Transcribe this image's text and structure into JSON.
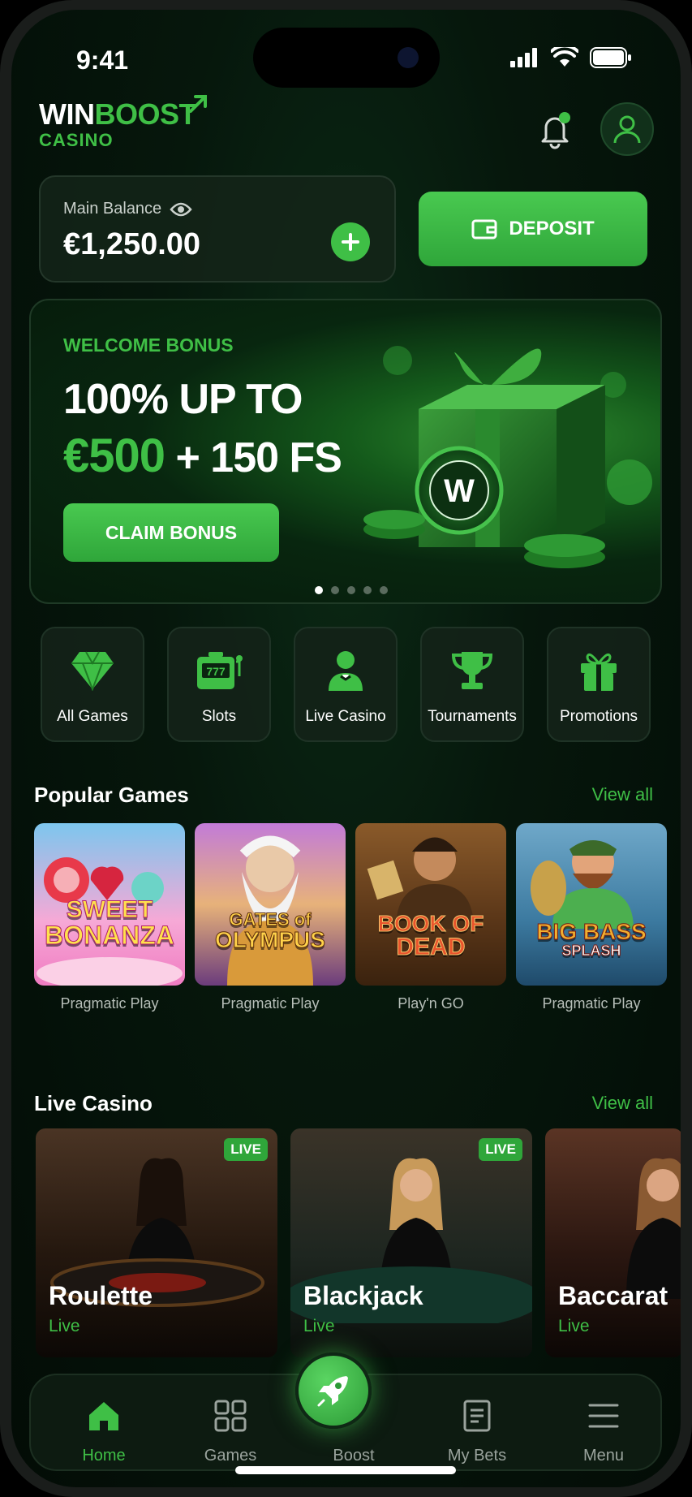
{
  "status_bar": {
    "time": "9:41"
  },
  "header": {
    "logo_win": "WIN",
    "logo_boost": "BOOST",
    "logo_sub": "CASINO"
  },
  "balance": {
    "label": "Main Balance",
    "value": "€1,250.00"
  },
  "deposit": {
    "label": "DEPOSIT"
  },
  "promo": {
    "kicker": "WELCOME BONUS",
    "line1": "100% UP TO",
    "amount": "€500",
    "line2_rest": "+ 150 FS",
    "cta": "CLAIM BONUS",
    "slide_count": 5,
    "active_slide": 1
  },
  "categories": [
    {
      "label": "All Games",
      "icon": "diamond-icon"
    },
    {
      "label": "Slots",
      "icon": "slot-machine-icon"
    },
    {
      "label": "Live Casino",
      "icon": "dealer-icon"
    },
    {
      "label": "Tournaments",
      "icon": "trophy-icon"
    },
    {
      "label": "Promotions",
      "icon": "gift-icon"
    }
  ],
  "popular": {
    "title": "Popular Games",
    "view_all": "View all",
    "games": [
      {
        "name_line1": "SWEET",
        "name_line2": "BONANZA",
        "provider": "Pragmatic Play"
      },
      {
        "name_line1": "GATES of",
        "name_line2": "OLYMPUS",
        "provider": "Pragmatic Play"
      },
      {
        "name_line1": "BOOK OF",
        "name_line2": "DEAD",
        "provider": "Play'n GO"
      },
      {
        "name_line1": "BIG BASS",
        "name_line2": "SPLASH",
        "provider": "Pragmatic Play"
      }
    ]
  },
  "live_casino": {
    "title": "Live Casino",
    "view_all": "View all",
    "tables": [
      {
        "name": "Roulette",
        "status": "Live",
        "badge": "LIVE"
      },
      {
        "name": "Blackjack",
        "status": "Live",
        "badge": "LIVE"
      },
      {
        "name": "Baccarat",
        "status": "Live",
        "badge": ""
      }
    ]
  },
  "nav": {
    "items": [
      {
        "label": "Home",
        "icon": "home-icon",
        "active": true
      },
      {
        "label": "Games",
        "icon": "grid-icon",
        "active": false
      },
      {
        "label": "Boost",
        "icon": "rocket-icon",
        "active": false
      },
      {
        "label": "My Bets",
        "icon": "receipt-icon",
        "active": false
      },
      {
        "label": "Menu",
        "icon": "menu-icon",
        "active": false
      }
    ]
  },
  "colors": {
    "accent": "#3fbf46",
    "background": "#06170c",
    "card": "#142419"
  }
}
